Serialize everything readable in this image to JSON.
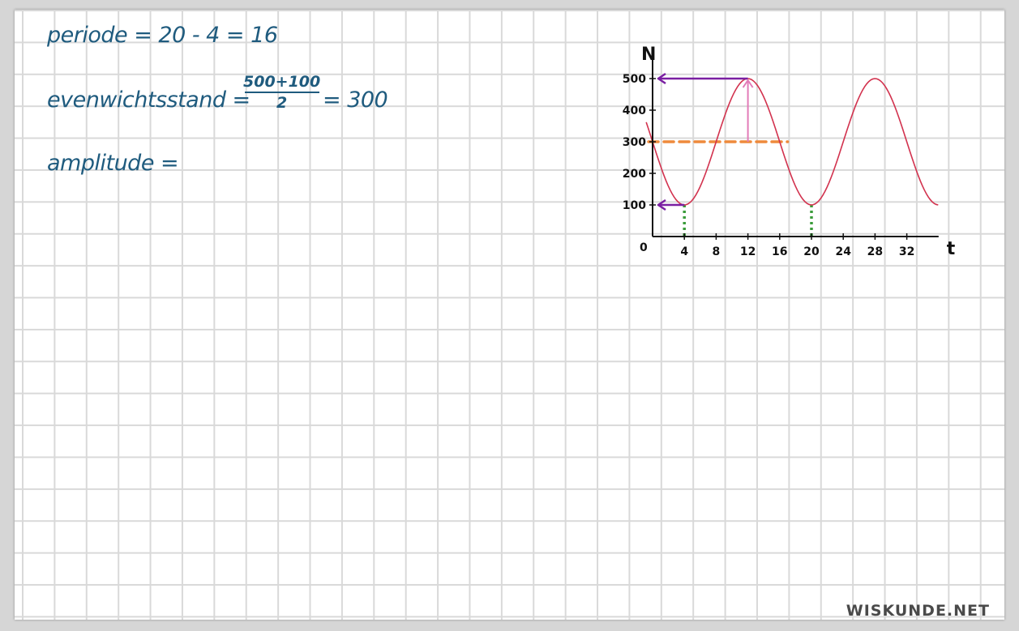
{
  "notes": {
    "line1": "periode = 20 - 4 = 16",
    "line2_prefix": "evenwichtsstand =",
    "fraction_numerator": "500+100",
    "fraction_denominator": "2",
    "line2_suffix": "= 300",
    "line3": "amplitude ="
  },
  "brand": "WISKUNDE.NET",
  "colors": {
    "ink": "#1f5b7e",
    "curve": "#d2324e",
    "arrow_purple": "#7a1fa2",
    "arrow_pink": "#e27bb8",
    "dash_orange": "#ee8a3c",
    "dash_green": "#3a9c3a"
  },
  "chart_data": {
    "type": "line",
    "xlabel": "t",
    "ylabel": "N",
    "x_ticks": [
      4,
      8,
      12,
      16,
      20,
      24,
      28,
      32
    ],
    "y_ticks": [
      100,
      200,
      300,
      400,
      500
    ],
    "origin_label": "0",
    "xlim": [
      0,
      36
    ],
    "ylim": [
      0,
      500
    ],
    "series": [
      {
        "equilibrium": 300,
        "amplitude": 200,
        "period": 16,
        "phase_min_at": 4,
        "x": [
          0,
          2,
          4,
          6,
          8,
          10,
          12,
          14,
          16,
          18,
          20,
          22,
          24,
          26,
          28,
          30,
          32,
          34,
          36
        ],
        "y": [
          300,
          159,
          100,
          159,
          300,
          441,
          500,
          441,
          300,
          159,
          100,
          159,
          300,
          441,
          500,
          441,
          300,
          159,
          100
        ]
      }
    ],
    "annotations": {
      "max_arrow_to_y": 500,
      "min_arrow_to_y": 100,
      "equilibrium_dash_y": 300,
      "equilibrium_dash_x_end": 17,
      "vertical_arrow_x": 12,
      "vertical_arrow_from": 300,
      "vertical_arrow_to": 500,
      "min_markers_x": [
        4,
        20
      ]
    }
  }
}
